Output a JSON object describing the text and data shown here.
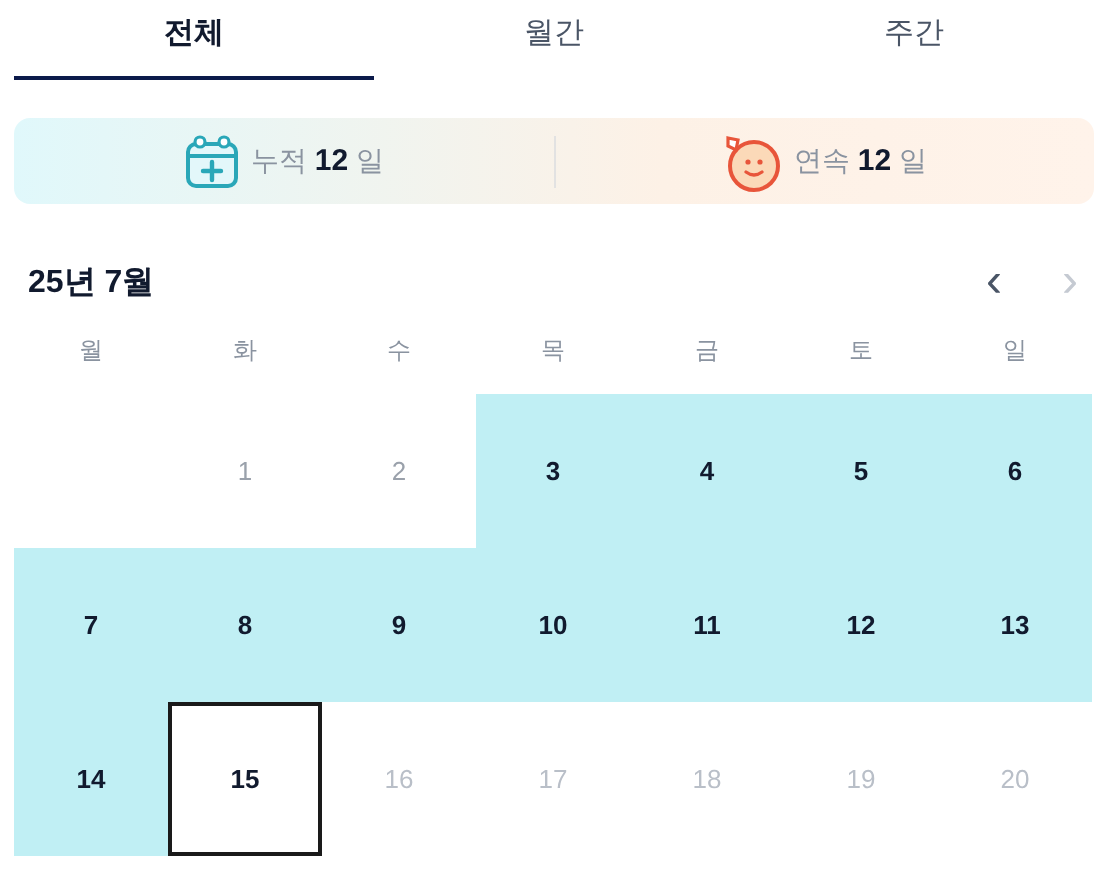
{
  "tabs": [
    {
      "label": "전체",
      "selected": true
    },
    {
      "label": "월간",
      "selected": false
    },
    {
      "label": "주간",
      "selected": false
    }
  ],
  "stats": [
    {
      "kind": "total",
      "text": "누적 **12** 일"
    },
    {
      "kind": "streak",
      "text": "연속 **12** 일"
    }
  ],
  "calendar": {
    "title": "25년 7월",
    "prev": {
      "label": "‹",
      "disabled": false
    },
    "next": {
      "label": "›",
      "disabled": true
    },
    "weekdays": [
      "월",
      "화",
      "수",
      "목",
      "금",
      "토",
      "일"
    ],
    "weeks": [
      [
        {
          "kind": "empty"
        },
        {
          "day": "1",
          "kind": "missed"
        },
        {
          "day": "2",
          "kind": "missed"
        },
        {
          "day": "3",
          "kind": "attended"
        },
        {
          "day": "4",
          "kind": "attended"
        },
        {
          "day": "5",
          "kind": "attended"
        },
        {
          "day": "6",
          "kind": "attended"
        }
      ],
      [
        {
          "day": "7",
          "kind": "attended"
        },
        {
          "day": "8",
          "kind": "attended"
        },
        {
          "day": "9",
          "kind": "attended"
        },
        {
          "day": "10",
          "kind": "attended"
        },
        {
          "day": "11",
          "kind": "attended"
        },
        {
          "day": "12",
          "kind": "attended"
        },
        {
          "day": "13",
          "kind": "attended"
        }
      ],
      [
        {
          "day": "14",
          "kind": "attended"
        },
        {
          "day": "15",
          "kind": "today"
        },
        {
          "day": "16",
          "kind": "future"
        },
        {
          "day": "17",
          "kind": "future"
        },
        {
          "day": "18",
          "kind": "future"
        },
        {
          "day": "19",
          "kind": "future"
        },
        {
          "day": "20",
          "kind": "future"
        }
      ]
    ]
  }
}
